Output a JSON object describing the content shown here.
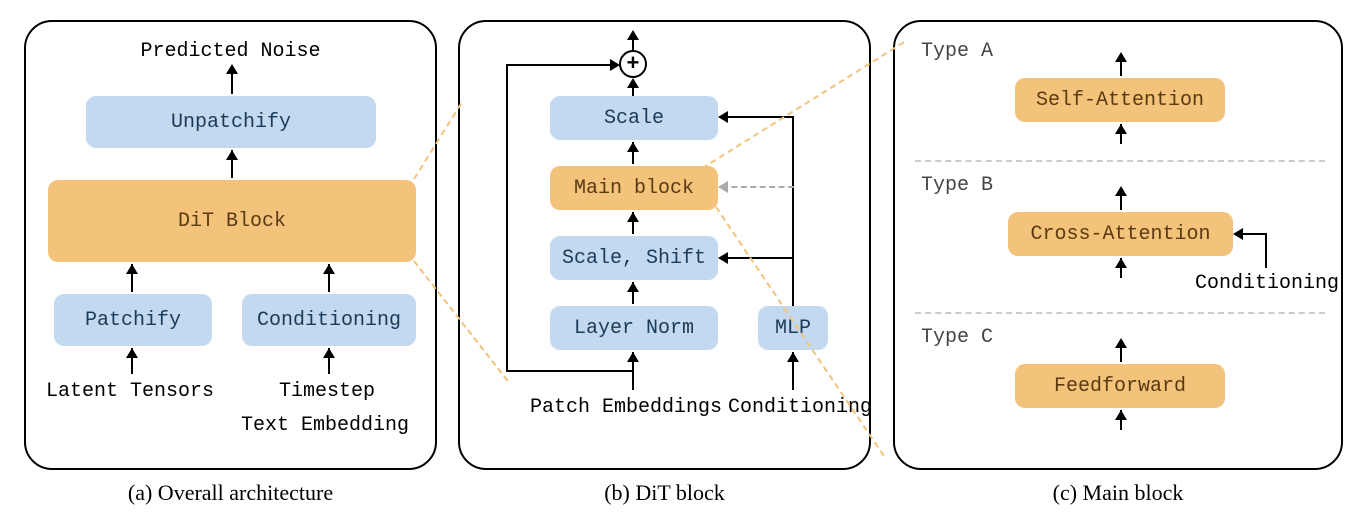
{
  "captions": {
    "a": "(a) Overall architecture",
    "b": "(b) DiT block",
    "c": "(c) Main block"
  },
  "panelA": {
    "predicted_noise": "Predicted Noise",
    "unpatchify": "Unpatchify",
    "dit_block": "DiT Block",
    "patchify": "Patchify",
    "conditioning": "Conditioning",
    "latent_tensors": "Latent Tensors",
    "timestep": "Timestep",
    "text_embedding": "Text Embedding"
  },
  "panelB": {
    "scale": "Scale",
    "main_block": "Main block",
    "scale_shift": "Scale, Shift",
    "layer_norm": "Layer Norm",
    "mlp": "MLP",
    "patch_embeddings": "Patch Embeddings",
    "conditioning": "Conditioning",
    "plus": "+"
  },
  "panelC": {
    "type_a": "Type A",
    "type_b": "Type B",
    "type_c": "Type C",
    "self_attention": "Self-Attention",
    "cross_attention": "Cross-Attention",
    "feedforward": "Feedforward",
    "conditioning": "Conditioning"
  }
}
